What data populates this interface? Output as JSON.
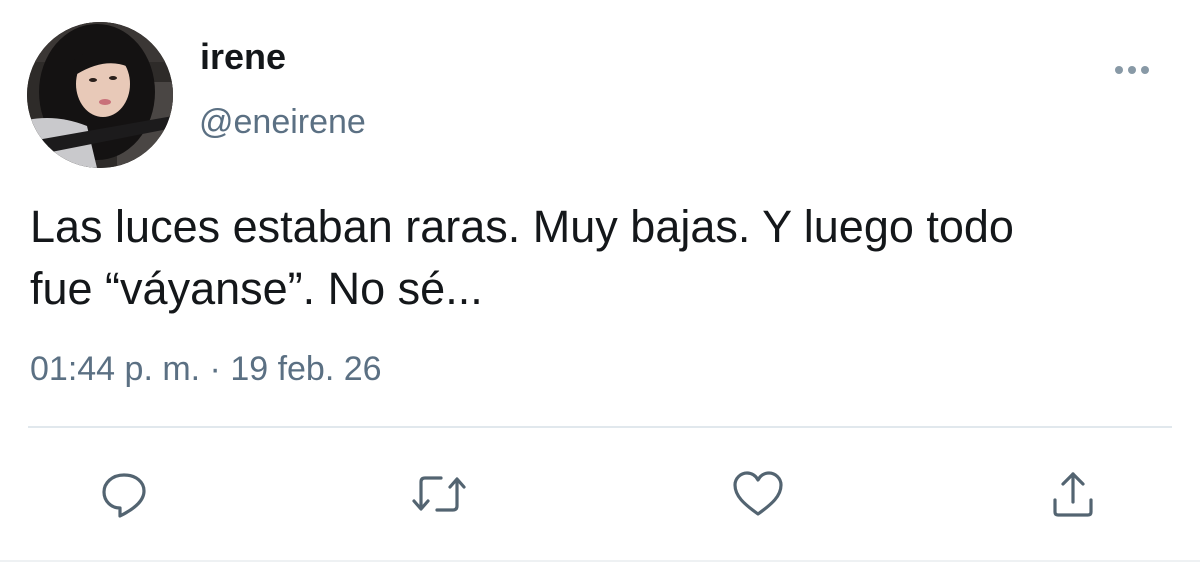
{
  "user": {
    "display_name": "irene",
    "handle": "@eneirene"
  },
  "tweet": {
    "text": "Las luces estaban raras. Muy bajas. Y luego todo\nfue “váyanse”. No sé...",
    "timestamp": "01:44 p. m. · 19 feb. 26"
  },
  "actions": [
    {
      "name": "reply",
      "icon": "speech-bubble-icon"
    },
    {
      "name": "retweet",
      "icon": "retweet-icon"
    },
    {
      "name": "like",
      "icon": "heart-icon"
    },
    {
      "name": "share",
      "icon": "share-upload-icon"
    }
  ],
  "colors": {
    "text_primary": "#14171a",
    "text_secondary": "#5b7083",
    "icon": "#536471",
    "divider": "#e1e8ed"
  }
}
